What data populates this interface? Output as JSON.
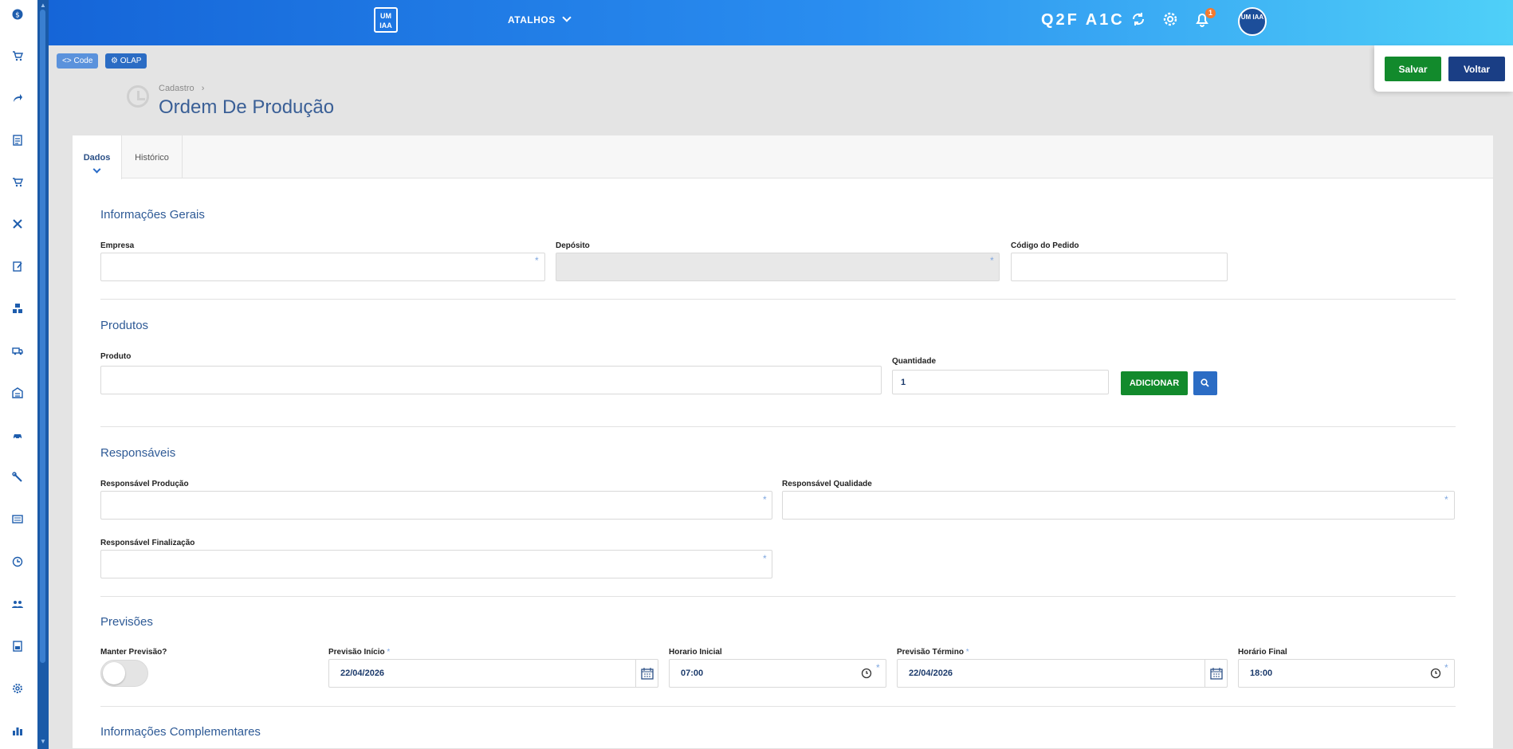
{
  "header": {
    "logo_text": "UM IAA",
    "shortcuts_label": "ATALHOS",
    "env_code": "Q2F A1C",
    "notification_count": "1",
    "avatar_text": "UM IAA"
  },
  "dev_buttons": {
    "code": "Code",
    "olap": "OLAP"
  },
  "actions": {
    "save": "Salvar",
    "back": "Voltar"
  },
  "page": {
    "breadcrumb": "Cadastro",
    "breadcrumb_sep": "›",
    "title": "Ordem De Produção"
  },
  "tabs": [
    {
      "label": "Dados"
    },
    {
      "label": "Histórico"
    }
  ],
  "sections": {
    "general": {
      "title": "Informações Gerais",
      "empresa_label": "Empresa",
      "deposito_label": "Depósito",
      "codigo_pedido_label": "Código do Pedido"
    },
    "products": {
      "title": "Produtos",
      "produto_label": "Produto",
      "quantidade_label": "Quantidade",
      "quantidade_value": "1",
      "add_button": "ADICIONAR"
    },
    "responsibles": {
      "title": "Responsáveis",
      "producao_label": "Responsável Produção",
      "qualidade_label": "Responsável Qualidade",
      "finalizacao_label": "Responsável Finalização"
    },
    "forecasts": {
      "title": "Previsões",
      "manter_label": "Manter Previsão?",
      "manter_value": false,
      "inicio_label": "Previsão Início",
      "inicio_value": "22/04/2026",
      "horario_inicial_label": "Horario Inicial",
      "horario_inicial_value": "07:00",
      "termino_label": "Previsão Término",
      "termino_value": "22/04/2026",
      "horario_final_label": "Horário Final",
      "horario_final_value": "18:00"
    },
    "complementary": {
      "title": "Informações Complementares"
    }
  },
  "required_mark": "*",
  "rail_icons": [
    "dollar-icon",
    "cart-icon",
    "share-icon",
    "document-icon",
    "cart-add-icon",
    "tools-icon",
    "edit-document-icon",
    "boxes-icon",
    "truck-icon",
    "warehouse-icon",
    "car-icon",
    "wrench-icon",
    "monitor-icon",
    "clock-icon",
    "users-icon",
    "report-icon",
    "settings-icon",
    "chart-icon"
  ],
  "colors": {
    "header_start": "#1565d8",
    "header_end": "#4fd0f8",
    "primary": "#2b6cc4",
    "success": "#128a2c",
    "navy": "#1a3e85"
  }
}
